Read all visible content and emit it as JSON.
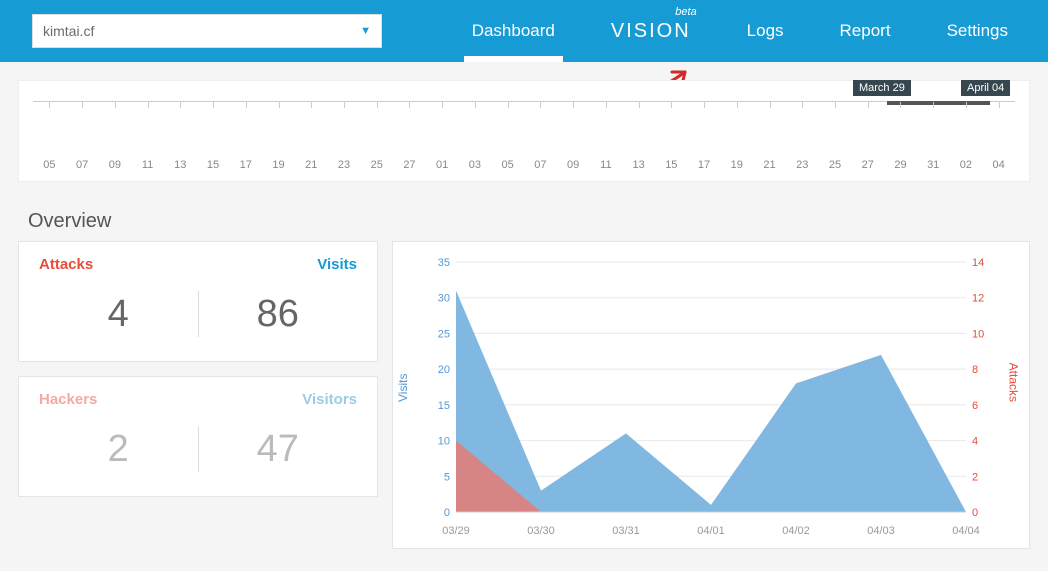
{
  "header": {
    "site_selected": "kimtai.cf",
    "nav": {
      "dashboard": "Dashboard",
      "vision": "VISION",
      "vision_tag": "beta",
      "logs": "Logs",
      "report": "Report",
      "settings": "Settings"
    }
  },
  "timeline": {
    "start_tag": "March 29",
    "end_tag": "April 04",
    "labels": [
      "05",
      "07",
      "09",
      "11",
      "13",
      "15",
      "17",
      "19",
      "21",
      "23",
      "25",
      "27",
      "01",
      "03",
      "05",
      "07",
      "09",
      "11",
      "13",
      "15",
      "17",
      "19",
      "21",
      "23",
      "25",
      "27",
      "29",
      "31",
      "02",
      "04"
    ]
  },
  "overview": {
    "title": "Overview",
    "cards": [
      {
        "left_label": "Attacks",
        "left_value": "4",
        "right_label": "Visits",
        "right_value": "86"
      },
      {
        "left_label": "Hackers",
        "left_value": "2",
        "right_label": "Visitors",
        "right_value": "47"
      }
    ]
  },
  "chart_data": {
    "type": "area",
    "title": "",
    "xlabel": "",
    "ylabel_left": "Visits",
    "ylabel_right": "Attacks",
    "categories": [
      "03/29",
      "03/30",
      "03/31",
      "04/01",
      "04/02",
      "04/03",
      "04/04"
    ],
    "series": [
      {
        "name": "Visits",
        "axis": "left",
        "color": "#6aacdc",
        "values": [
          31,
          3,
          11,
          1,
          18,
          22,
          0
        ]
      },
      {
        "name": "Attacks",
        "axis": "right",
        "color": "#e67b73",
        "values": [
          4,
          0,
          0,
          0,
          0,
          0,
          0
        ]
      }
    ],
    "ylim_left": [
      0,
      35
    ],
    "yticks_left": [
      0,
      5,
      10,
      15,
      20,
      25,
      30,
      35
    ],
    "ylim_right": [
      0,
      14
    ],
    "yticks_right": [
      0,
      2,
      4,
      6,
      8,
      10,
      12,
      14
    ]
  }
}
